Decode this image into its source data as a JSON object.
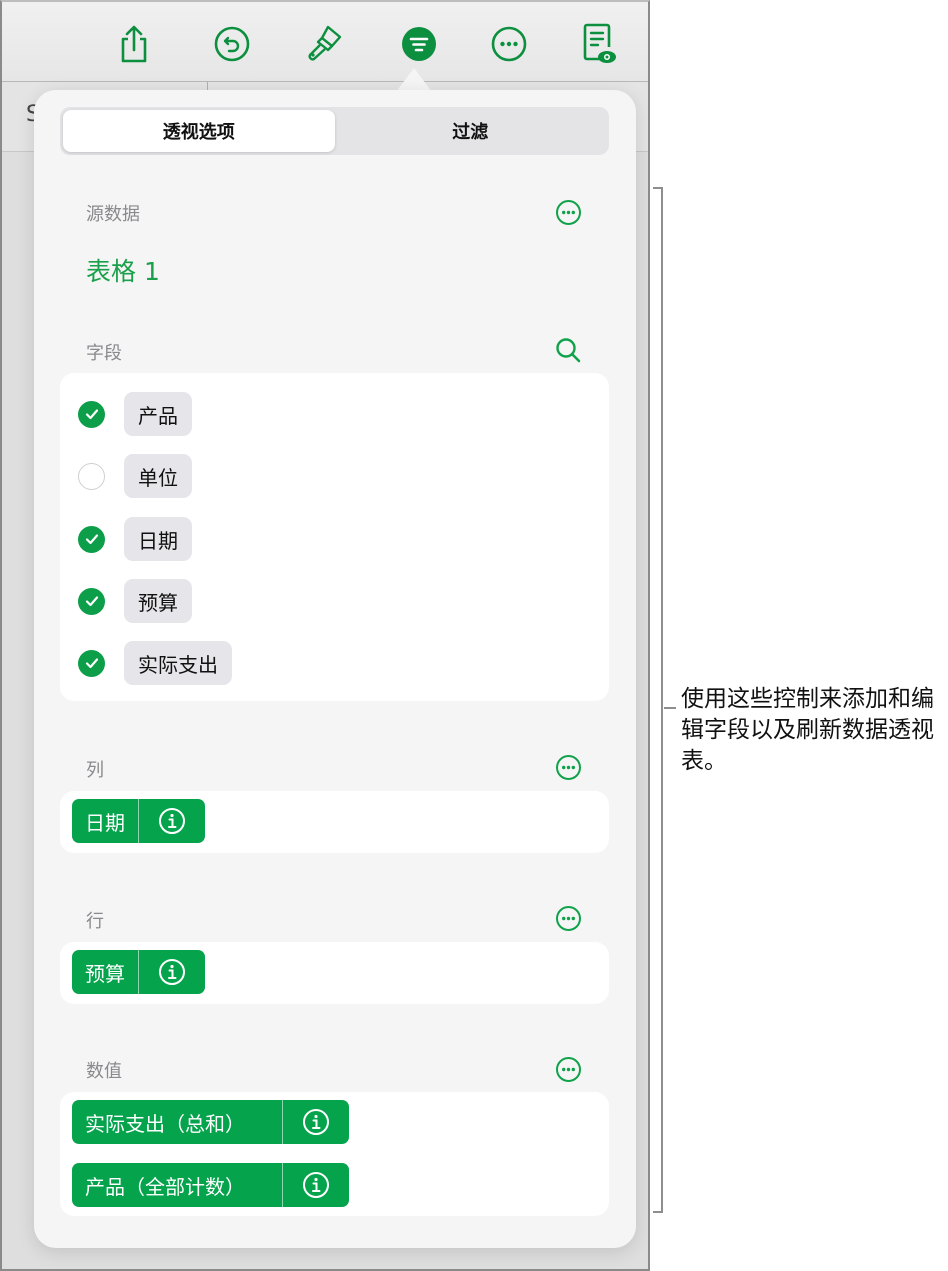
{
  "toolbar": {
    "buttons": [
      {
        "name": "share",
        "icon": "share-icon"
      },
      {
        "name": "undo",
        "icon": "undo-icon"
      },
      {
        "name": "format",
        "icon": "paintbrush-icon"
      },
      {
        "name": "organize",
        "icon": "filter-icon",
        "active": true
      },
      {
        "name": "more",
        "icon": "ellipsis-icon"
      },
      {
        "name": "view",
        "icon": "document-eye-icon"
      }
    ],
    "accent": "#0c8f3f"
  },
  "background": {
    "partial_letter": "S"
  },
  "popover": {
    "tabs": [
      {
        "label": "透视选项",
        "active": true
      },
      {
        "label": "过滤",
        "active": false
      }
    ],
    "source": {
      "label": "源数据",
      "value": "表格 1"
    },
    "fields": {
      "label": "字段",
      "items": [
        {
          "label": "产品",
          "checked": true
        },
        {
          "label": "单位",
          "checked": false
        },
        {
          "label": "日期",
          "checked": true
        },
        {
          "label": "预算",
          "checked": true
        },
        {
          "label": "实际支出",
          "checked": true
        }
      ]
    },
    "columns": {
      "label": "列",
      "items": [
        {
          "label": "日期"
        }
      ]
    },
    "rows": {
      "label": "行",
      "items": [
        {
          "label": "预算"
        }
      ]
    },
    "values": {
      "label": "数值",
      "items": [
        {
          "label": "实际支出（总和）"
        },
        {
          "label": "产品（全部计数）"
        }
      ]
    }
  },
  "callout": {
    "text": "使用这些控制来添加和编辑字段以及刷新数据透视表。"
  },
  "colors": {
    "green": "#04a34c",
    "label_gray": "#8a8a8e",
    "source_green": "#1aa04a"
  }
}
